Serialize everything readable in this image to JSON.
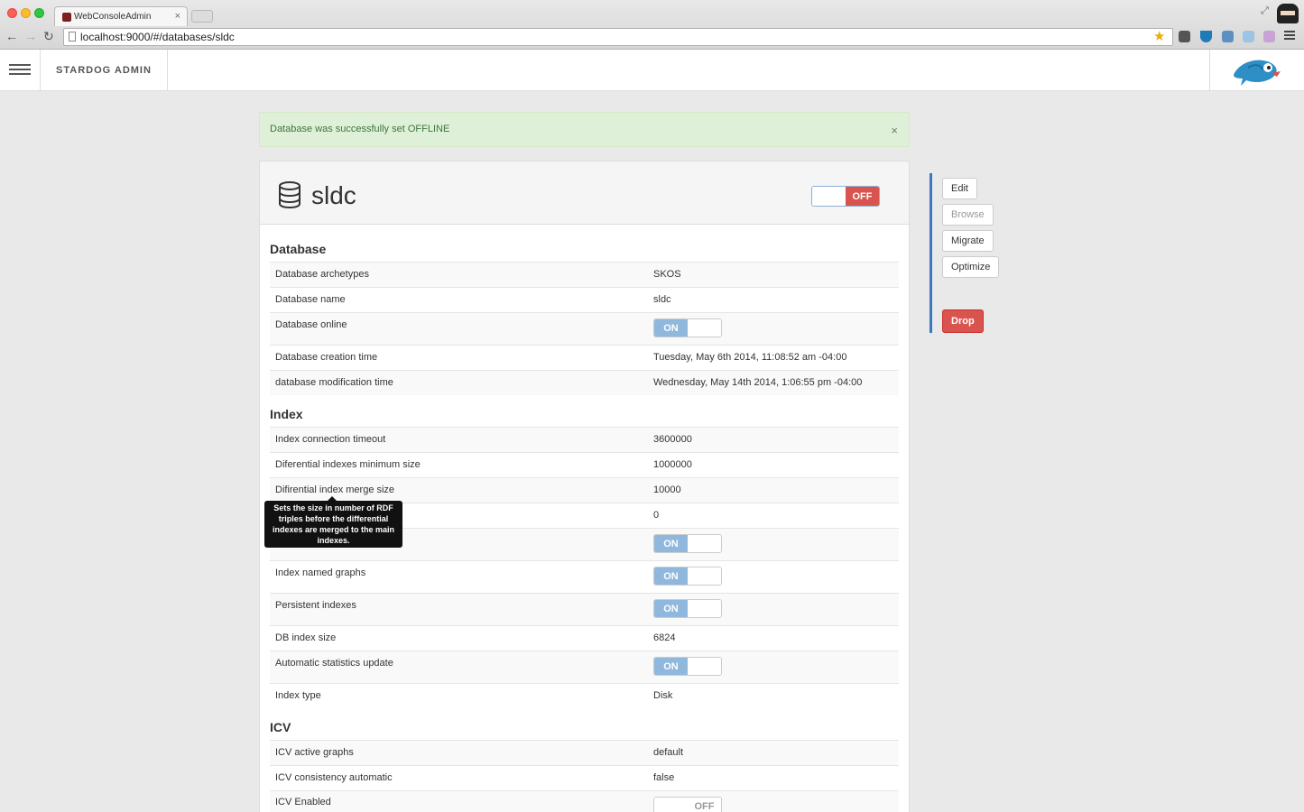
{
  "browser": {
    "tab_title": "WebConsoleAdmin",
    "url": "localhost:9000/#/databases/sldc"
  },
  "app": {
    "brand": "STARDOG ADMIN"
  },
  "alert": {
    "message": "Database was successfully set OFFLINE",
    "close": "×"
  },
  "database": {
    "name": "sldc",
    "status_toggle": "OFF"
  },
  "sections": {
    "database": {
      "title": "Database",
      "rows": [
        {
          "label": "Database archetypes",
          "value": "SKOS"
        },
        {
          "label": "Database name",
          "value": "sldc"
        },
        {
          "label": "Database online",
          "toggle": "ON"
        },
        {
          "label": "Database creation time",
          "value": "Tuesday, May 6th 2014, 11:08:52 am -04:00"
        },
        {
          "label": "database modification time",
          "value": "Wednesday, May 14th 2014, 1:06:55 pm -04:00"
        }
      ]
    },
    "index": {
      "title": "Index",
      "rows": [
        {
          "label": "Index connection timeout",
          "value": "3600000"
        },
        {
          "label": "Diferential indexes minimum size",
          "value": "1000000"
        },
        {
          "label": "Difirential index merge size",
          "value": "10000"
        },
        {
          "label": "",
          "value": "0"
        },
        {
          "label": "",
          "toggle": "ON"
        },
        {
          "label": "Index named graphs",
          "toggle": "ON"
        },
        {
          "label": "Persistent indexes",
          "toggle": "ON"
        },
        {
          "label": "DB index size",
          "value": "6824"
        },
        {
          "label": "Automatic statistics update",
          "toggle": "ON"
        },
        {
          "label": "Index type",
          "value": "Disk"
        }
      ]
    },
    "icv": {
      "title": "ICV",
      "rows": [
        {
          "label": "ICV active graphs",
          "value": "default"
        },
        {
          "label": "ICV consistency automatic",
          "value": "false"
        },
        {
          "label": "ICV Enabled",
          "toggle": "OFF"
        }
      ]
    }
  },
  "tooltip": "Sets the size in number of RDF triples before the differential indexes are merged to the main indexes.",
  "actions": {
    "edit": "Edit",
    "browse": "Browse",
    "migrate": "Migrate",
    "optimize": "Optimize",
    "drop": "Drop"
  },
  "colors": {
    "toggle_on": "#90b8dd",
    "toggle_off_active": "#d9534f",
    "alert_bg": "#dff0d8",
    "side_accent": "#3a78c2"
  }
}
